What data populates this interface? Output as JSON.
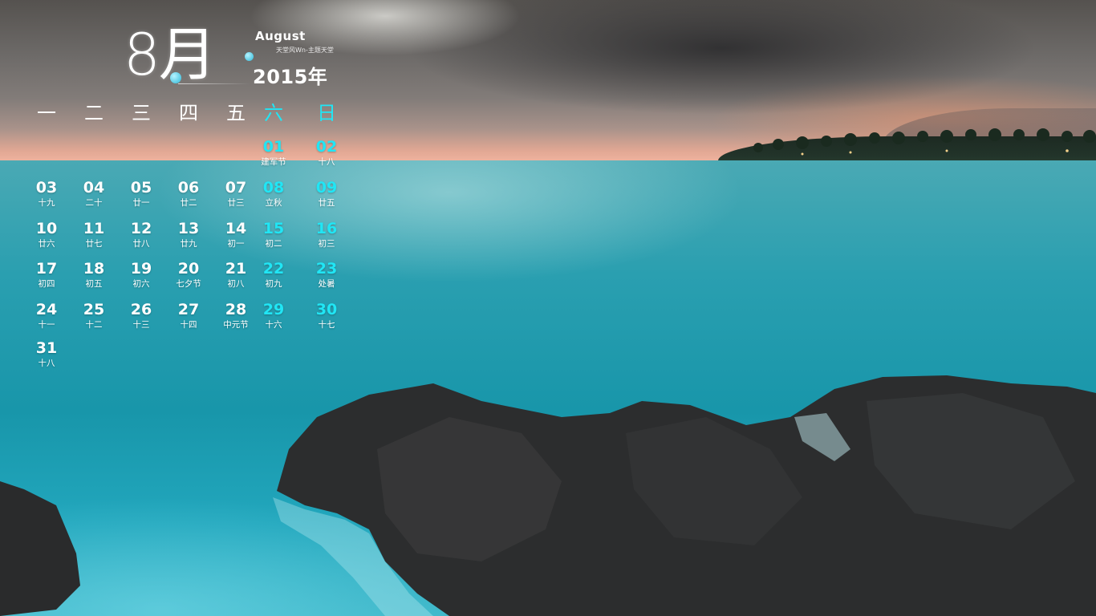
{
  "header": {
    "month": "8月",
    "month_en": "August",
    "credit": "天堂风Wn-主题天堂",
    "year": "2015年"
  },
  "weekdays": [
    "一",
    "二",
    "三",
    "四",
    "五",
    "六",
    "日"
  ],
  "days": [
    {
      "num": "01",
      "lunar": "建军节"
    },
    {
      "num": "02",
      "lunar": "十八"
    },
    {
      "num": "03",
      "lunar": "十九"
    },
    {
      "num": "04",
      "lunar": "二十"
    },
    {
      "num": "05",
      "lunar": "廿一"
    },
    {
      "num": "06",
      "lunar": "廿二"
    },
    {
      "num": "07",
      "lunar": "廿三"
    },
    {
      "num": "08",
      "lunar": "立秋"
    },
    {
      "num": "09",
      "lunar": "廿五"
    },
    {
      "num": "10",
      "lunar": "廿六"
    },
    {
      "num": "11",
      "lunar": "廿七"
    },
    {
      "num": "12",
      "lunar": "廿八"
    },
    {
      "num": "13",
      "lunar": "廿九"
    },
    {
      "num": "14",
      "lunar": "初一"
    },
    {
      "num": "15",
      "lunar": "初二"
    },
    {
      "num": "16",
      "lunar": "初三"
    },
    {
      "num": "17",
      "lunar": "初四"
    },
    {
      "num": "18",
      "lunar": "初五"
    },
    {
      "num": "19",
      "lunar": "初六"
    },
    {
      "num": "20",
      "lunar": "七夕节"
    },
    {
      "num": "21",
      "lunar": "初八"
    },
    {
      "num": "22",
      "lunar": "初九"
    },
    {
      "num": "23",
      "lunar": "处暑"
    },
    {
      "num": "24",
      "lunar": "十一"
    },
    {
      "num": "25",
      "lunar": "十二"
    },
    {
      "num": "26",
      "lunar": "十三"
    },
    {
      "num": "27",
      "lunar": "十四"
    },
    {
      "num": "28",
      "lunar": "中元节"
    },
    {
      "num": "29",
      "lunar": "十六"
    },
    {
      "num": "30",
      "lunar": "十七"
    },
    {
      "num": "31",
      "lunar": "十八"
    }
  ],
  "colors": {
    "weekend_accent": "#20e6f5",
    "text": "#ffffff",
    "sea": "#1896aa",
    "rock": "#2a2b2c"
  }
}
